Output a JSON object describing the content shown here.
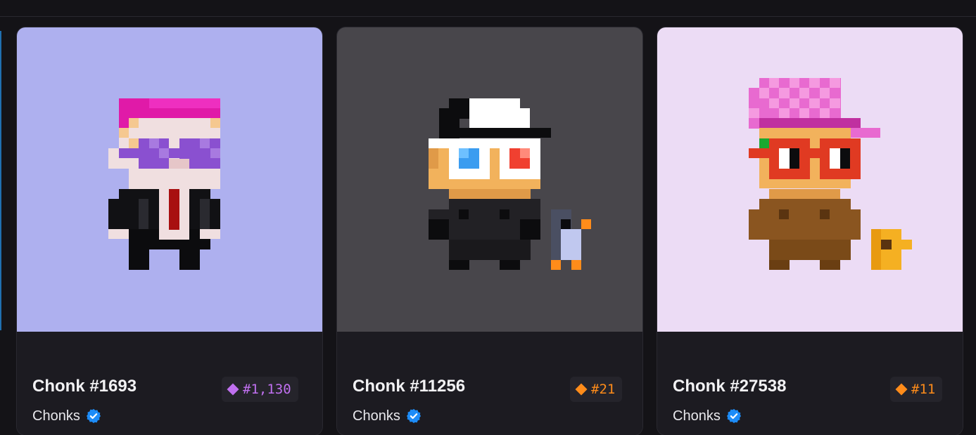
{
  "collection": {
    "name": "Chonks",
    "verified_icon": "verified-badge-icon",
    "verified_color": "#1d8cf8"
  },
  "cards": [
    {
      "title": "Chonk #1693",
      "collection": "Chonks",
      "rank": "#1,130",
      "rank_color": "#c070f0",
      "background": "#aeb0ef"
    },
    {
      "title": "Chonk #11256",
      "collection": "Chonks",
      "rank": "#21",
      "rank_color": "#ff8c1a",
      "background": "#48464b"
    },
    {
      "title": "Chonk #27538",
      "collection": "Chonks",
      "rank": "#11",
      "rank_color": "#ff8c1a",
      "background": "#ecdcf5"
    }
  ]
}
